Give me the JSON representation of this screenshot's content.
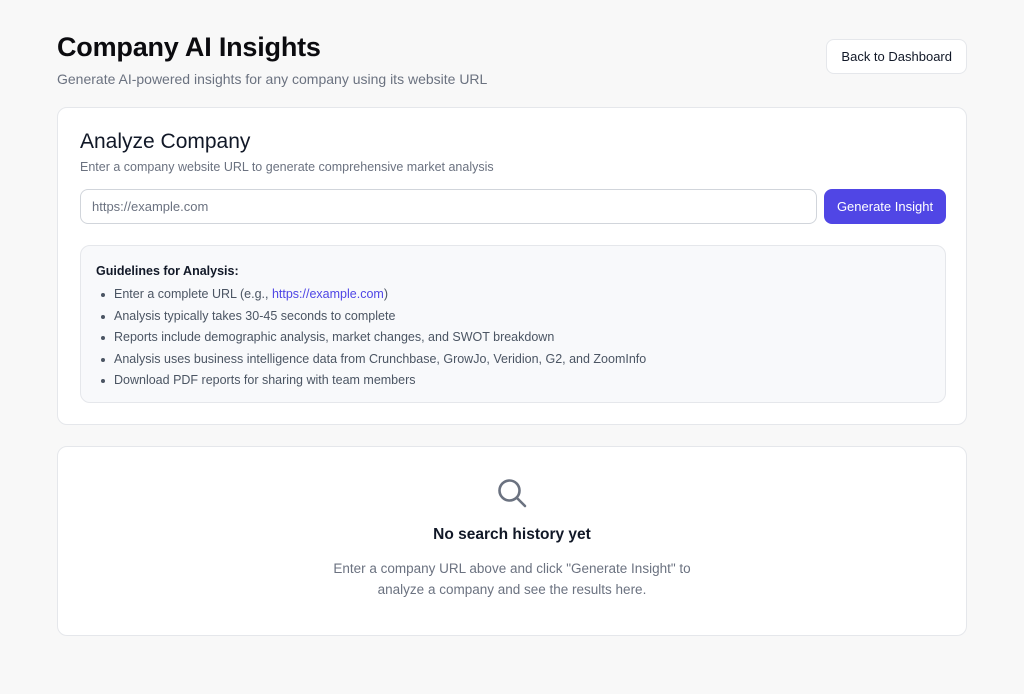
{
  "header": {
    "title": "Company AI Insights",
    "subtitle": "Generate AI-powered insights for any company using its website URL",
    "back_button": "Back to Dashboard"
  },
  "analyze": {
    "title": "Analyze Company",
    "description": "Enter a company website URL to generate comprehensive market analysis",
    "input_placeholder": "https://example.com",
    "input_value": "",
    "generate_button": "Generate Insight",
    "accent_color": "#5046e5"
  },
  "guidelines": {
    "title": "Guidelines for Analysis:",
    "item1_prefix": "Enter a complete URL (e.g., ",
    "item1_link": "https://example.com",
    "item1_suffix": ")",
    "items": [
      "Analysis typically takes 30-45 seconds to complete",
      "Reports include demographic analysis, market changes, and SWOT breakdown",
      "Analysis uses business intelligence data from Crunchbase, GrowJo, Veridion, G2, and ZoomInfo",
      "Download PDF reports for sharing with team members"
    ]
  },
  "history": {
    "icon": "search-icon",
    "empty_title": "No search history yet",
    "empty_description": "Enter a company URL above and click \"Generate Insight\" to analyze a company and see the results here."
  }
}
